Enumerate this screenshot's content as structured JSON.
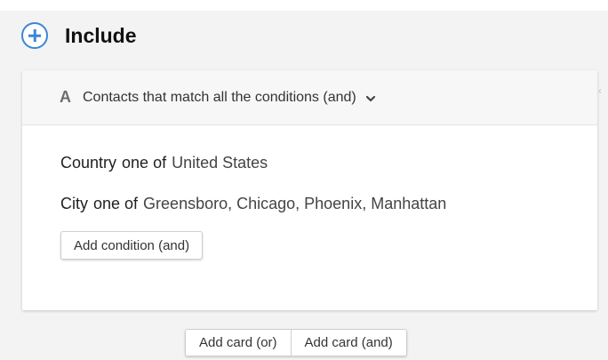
{
  "section": {
    "title": "Include",
    "add_icon": "plus-circle-icon"
  },
  "card": {
    "letter": "A",
    "match_text": "Contacts that match all the conditions (and)",
    "chevron_icon": "chevron-down-icon",
    "conditions": [
      {
        "field": "Country",
        "operator": "one of",
        "value": "United States"
      },
      {
        "field": "City",
        "operator": "one of",
        "value": "Greensboro, Chicago, Phoenix, Manhattan"
      }
    ],
    "add_condition_label": "Add condition (and)"
  },
  "actions": {
    "add_card_or_label": "Add card (or)",
    "add_card_and_label": "Add card (and)"
  },
  "colors": {
    "accent": "#3b86d8",
    "background": "#f3f3f3",
    "card_background": "#ffffff",
    "card_header_background": "#f7f7f7"
  }
}
